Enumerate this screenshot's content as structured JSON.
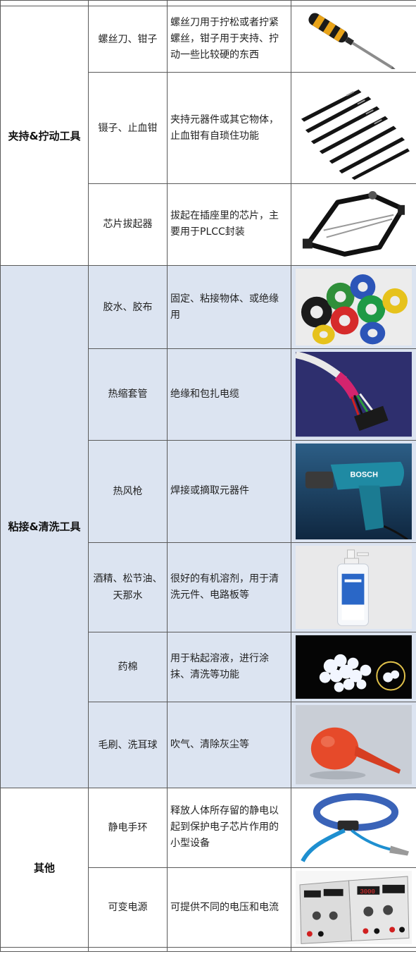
{
  "table": {
    "categories": [
      {
        "label": "夹持&拧动工具"
      },
      {
        "label": "粘接&清洗工具"
      },
      {
        "label": "其他"
      }
    ],
    "rows": [
      {
        "name": "螺丝刀、钳子",
        "desc": "螺丝刀用于拧松或者拧紧螺丝，钳子用于夹持、拧动一些比较硬的东西",
        "icon": "screwdriver-icon"
      },
      {
        "name": "镊子、止血钳",
        "desc": "夹持元器件或其它物体，止血钳有自琐住功能",
        "icon": "tweezers-icon"
      },
      {
        "name": "芯片拔起器",
        "desc": "拔起在插座里的芯片，主要用于PLCC封装",
        "icon": "chip-extractor-icon"
      },
      {
        "name": "胶水、胶布",
        "desc": "固定、粘接物体、或绝缘用",
        "icon": "tape-rolls-icon"
      },
      {
        "name": "热缩套管",
        "desc": "绝缘和包扎电缆",
        "icon": "heat-shrink-cable-icon"
      },
      {
        "name": "热风枪",
        "desc": "焊接或摘取元器件",
        "icon": "heat-gun-icon",
        "brand": "BOSCH"
      },
      {
        "name": "酒精、松节油、天那水",
        "desc": "很好的有机溶剂，用于清洗元件、电路板等",
        "icon": "alcohol-bottle-icon"
      },
      {
        "name": "药棉",
        "desc": "用于粘起溶液，进行涂抹、清洗等功能",
        "icon": "cotton-balls-icon"
      },
      {
        "name": "毛刷、洗耳球",
        "desc": "吹气、清除灰尘等",
        "icon": "ear-bulb-icon"
      },
      {
        "name": "静电手环",
        "desc": "释放人体所存留的静电以起到保护电子芯片作用的小型设备",
        "icon": "antistatic-wristband-icon"
      },
      {
        "name": "可变电源",
        "desc": "可提供不同的电压和电流",
        "icon": "power-supply-icon",
        "display": "3000"
      }
    ]
  },
  "colors": {
    "band_blue": "#dce4f1",
    "border": "#5a5a5a"
  }
}
